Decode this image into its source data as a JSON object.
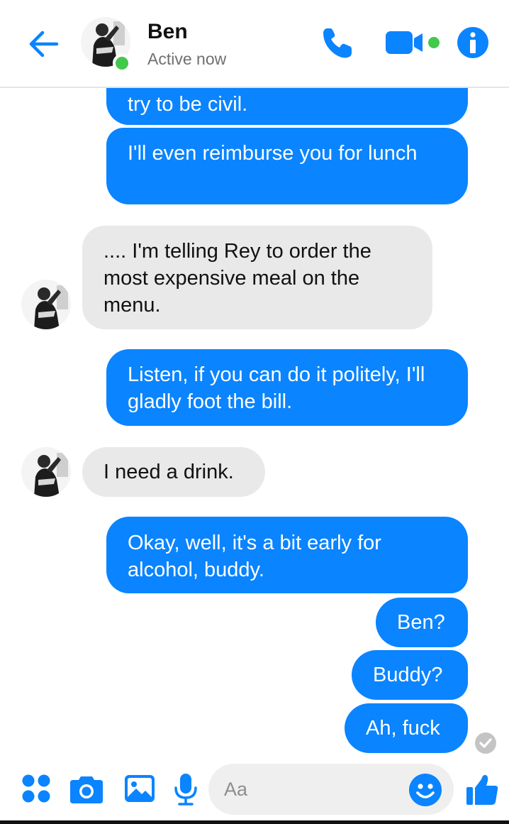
{
  "header": {
    "name": "Ben",
    "status": "Active now"
  },
  "messages": [
    {
      "from": "me",
      "text": "try to be civil."
    },
    {
      "from": "me",
      "text": "I'll even reimburse you for lunch"
    },
    {
      "from": "ben",
      "text": ".... I'm telling Rey to order the most expensive meal on the menu."
    },
    {
      "from": "me",
      "text": "Listen, if you can do it politely, I'll gladly foot the bill."
    },
    {
      "from": "ben",
      "text": "I need a drink."
    },
    {
      "from": "me",
      "text": "Okay, well, it's a bit early for alcohol, buddy."
    },
    {
      "from": "me",
      "text": "Ben?"
    },
    {
      "from": "me",
      "text": "Buddy?"
    },
    {
      "from": "me",
      "text": "Ah, fuck"
    }
  ],
  "composer": {
    "placeholder": "Aa"
  },
  "colors": {
    "accent": "#0a84ff",
    "incoming_bubble": "#e9e9e9",
    "online": "#42c84a"
  },
  "icons": [
    "back-arrow-icon",
    "phone-icon",
    "video-camera-icon",
    "info-icon",
    "menu-dots-icon",
    "camera-icon",
    "image-icon",
    "microphone-icon",
    "emoji-icon",
    "thumbs-up-icon",
    "seen-check-icon"
  ]
}
